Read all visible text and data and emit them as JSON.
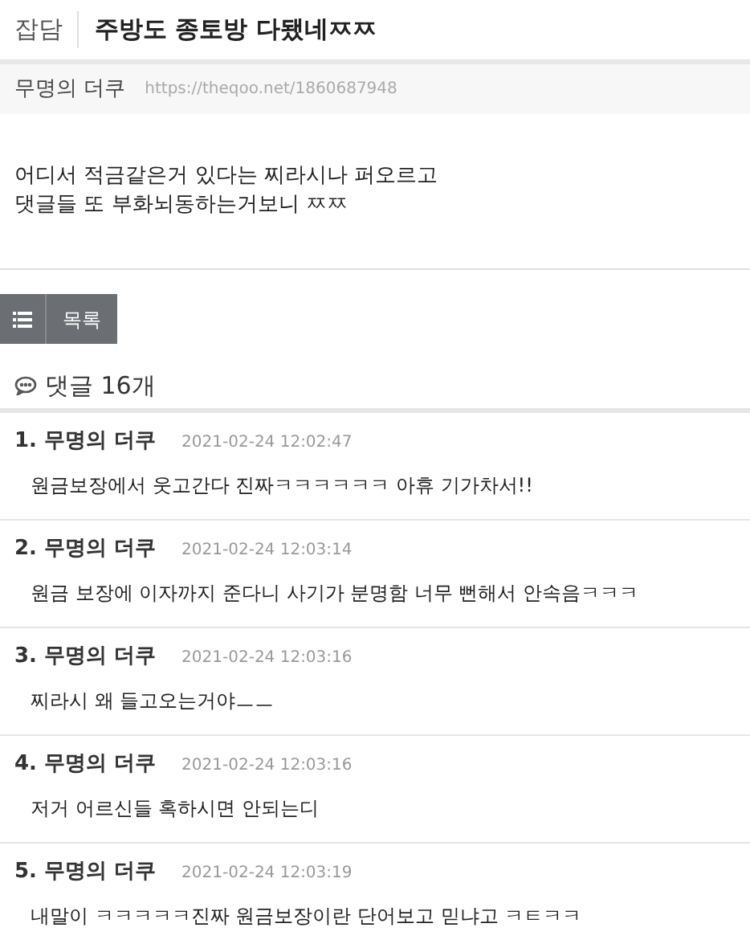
{
  "post": {
    "category": "잡담",
    "title": "주방도 종토방 다됐네ㅉㅉ",
    "author": "무명의 더쿠",
    "url": "https://theqoo.net/1860687948",
    "body": [
      "어디서 적금같은거 있다는 찌라시나 퍼오르고",
      "댓글들 또 부화뇌동하는거보니 ㅉㅉ"
    ]
  },
  "list_button": {
    "label": "목록"
  },
  "comments_header": {
    "label": "댓글 16개"
  },
  "comments": [
    {
      "author": "1. 무명의 더쿠",
      "time": "2021-02-24 12:02:47",
      "text": "원금보장에서 웃고간다 진짜ㅋㅋㅋㅋㅋㅋ 아휴 기가차서!!"
    },
    {
      "author": "2. 무명의 더쿠",
      "time": "2021-02-24 12:03:14",
      "text": "원금 보장에 이자까지 준다니 사기가 분명함 너무 뻔해서 안속음ㅋㅋㅋ"
    },
    {
      "author": "3. 무명의 더쿠",
      "time": "2021-02-24 12:03:16",
      "text": "찌라시 왜 들고오는거야ㅡㅡ"
    },
    {
      "author": "4. 무명의 더쿠",
      "time": "2021-02-24 12:03:16",
      "text": "저거 어르신들 혹하시면 안되는디"
    },
    {
      "author": "5. 무명의 더쿠",
      "time": "2021-02-24 12:03:19",
      "text": "내말이 ㅋㅋㅋㅋㅋ진짜 원금보장이란 단어보고 믿냐고 ㅋㅌㅋㅋ"
    }
  ]
}
